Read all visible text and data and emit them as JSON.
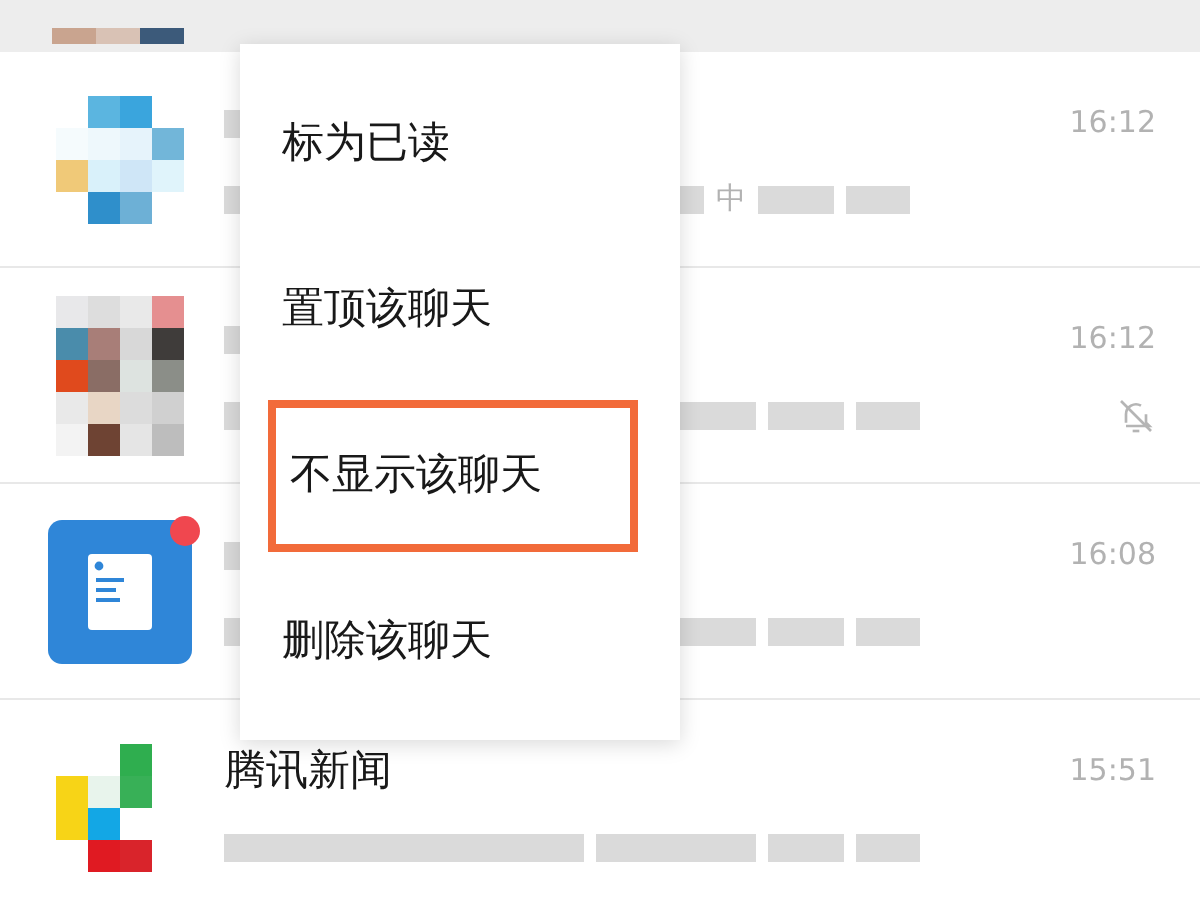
{
  "chats": [
    {
      "kind": "mosaic",
      "time": "16:12",
      "preview": "中",
      "muted": false,
      "unread": false
    },
    {
      "kind": "mosaic",
      "time": "16:12",
      "muted": true,
      "unread": false
    },
    {
      "kind": "document",
      "time": "16:08",
      "muted": false,
      "unread": true
    },
    {
      "kind": "mosaic",
      "name": "腾讯新闻",
      "time": "15:51",
      "muted": false,
      "unread": false
    }
  ],
  "menu": {
    "items": [
      {
        "label": "标为已读",
        "highlighted": false
      },
      {
        "label": "置顶该聊天",
        "highlighted": false
      },
      {
        "label": "不显示该聊天",
        "highlighted": true
      },
      {
        "label": "删除该聊天",
        "highlighted": false
      }
    ]
  }
}
